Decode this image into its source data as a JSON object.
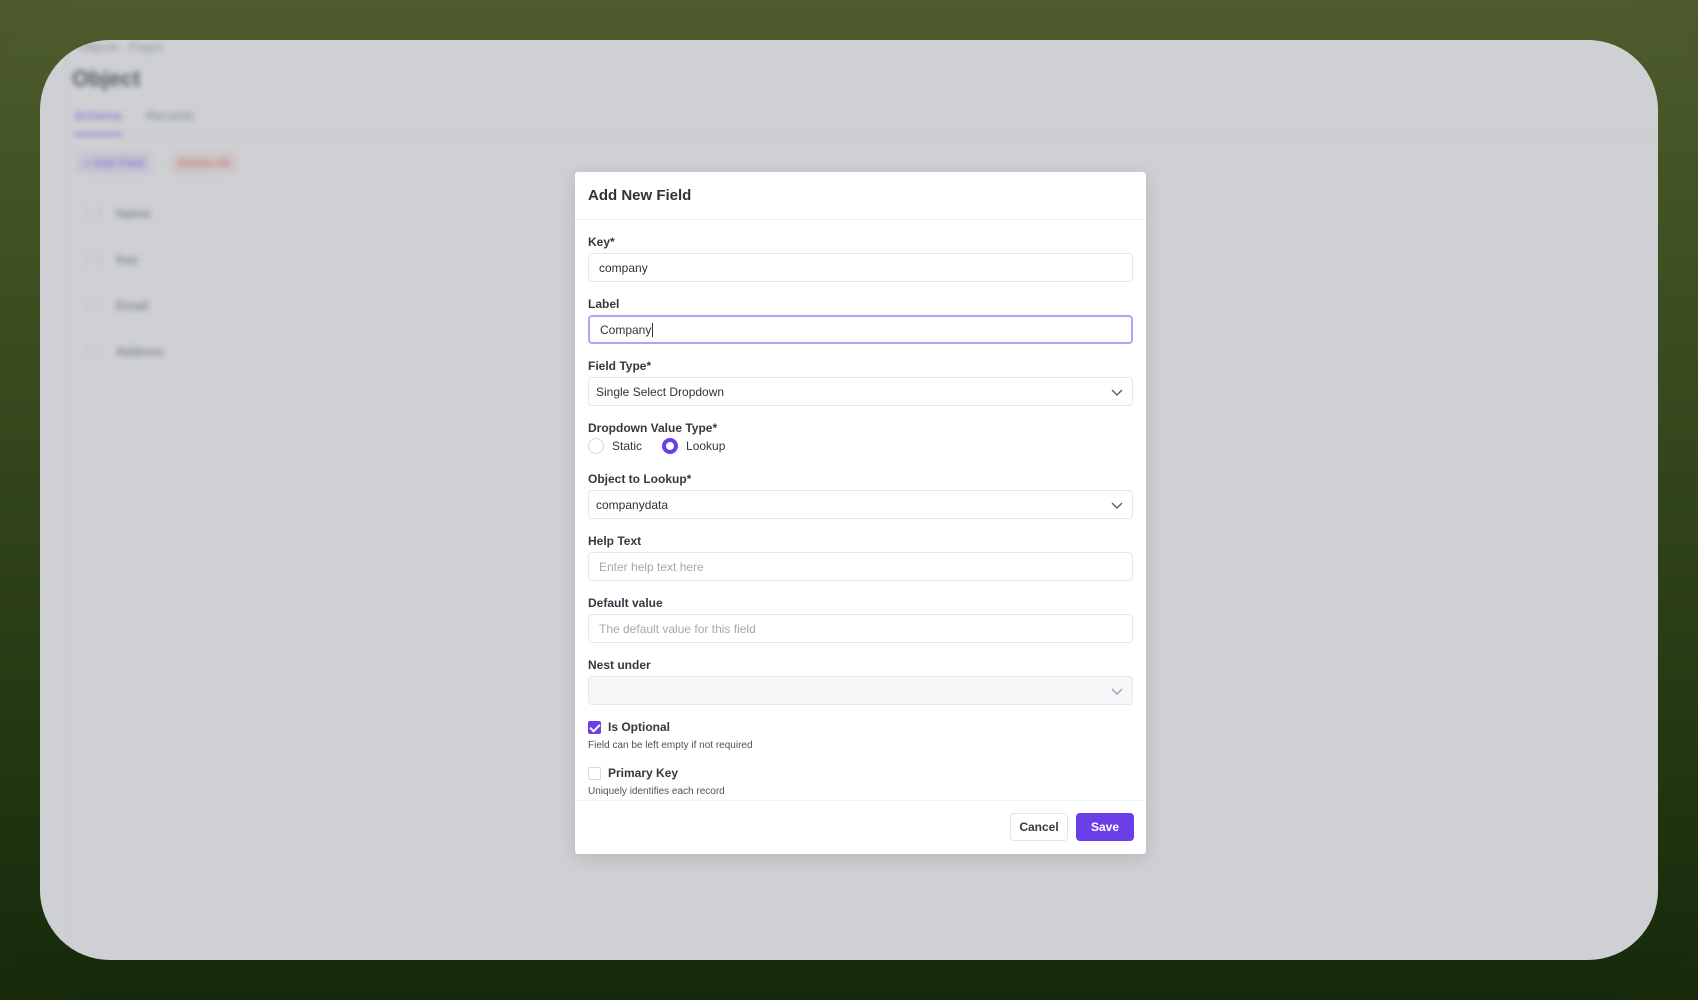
{
  "background": {
    "breadcrumb": "Objects · Pages",
    "title": "Object",
    "tabs": [
      {
        "label": "Schema",
        "active": true
      },
      {
        "label": "Records",
        "active": false
      }
    ],
    "actions": {
      "add": "+ Add Field",
      "delete": "Delete All"
    },
    "rows": [
      "Name",
      "Key",
      "Email",
      "Address"
    ]
  },
  "modal": {
    "title": "Add New Field",
    "key": {
      "label": "Key*",
      "value": "company"
    },
    "label": {
      "label": "Label",
      "value": "Company"
    },
    "field_type": {
      "label": "Field Type*",
      "value": "Single Select Dropdown"
    },
    "dropdown_value_type": {
      "label": "Dropdown Value Type*",
      "options": [
        {
          "label": "Static",
          "checked": false
        },
        {
          "label": "Lookup",
          "checked": true
        }
      ]
    },
    "object_to_lookup": {
      "label": "Object to Lookup*",
      "value": "companydata"
    },
    "help_text": {
      "label": "Help Text",
      "placeholder": "Enter help text here"
    },
    "default_value": {
      "label": "Default value",
      "placeholder": "The default value for this field"
    },
    "nest_under": {
      "label": "Nest under",
      "value": ""
    },
    "is_optional": {
      "label": "Is Optional",
      "help": "Field can be left empty if not required",
      "checked": true
    },
    "primary_key": {
      "label": "Primary Key",
      "help": "Uniquely identifies each record",
      "checked": false
    },
    "footer": {
      "cancel": "Cancel",
      "save": "Save"
    }
  },
  "colors": {
    "accent": "#6a3fe8",
    "focus_border": "#b3a3f6"
  }
}
